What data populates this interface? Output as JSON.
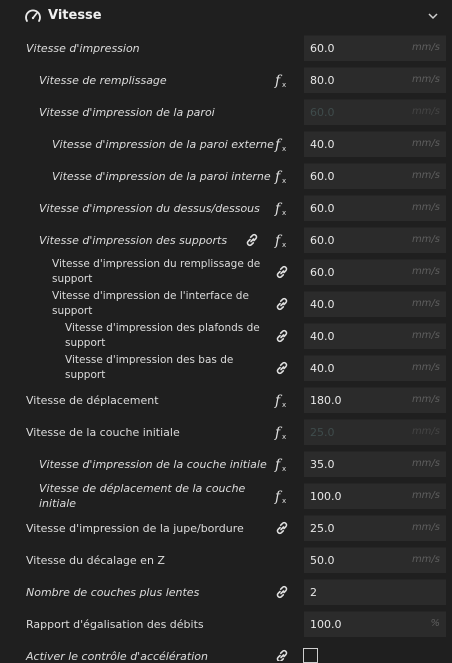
{
  "section": {
    "title": "Vitesse",
    "icon": "gauge-icon",
    "collapse_icon": "chevron-down-icon"
  },
  "rows": [
    {
      "label": "Vitesse d'impression",
      "value": "60.0",
      "unit": "mm/s",
      "icon": ""
    },
    {
      "label": "Vitesse de remplissage",
      "value": "80.0",
      "unit": "mm/s",
      "icon": "function-icon"
    },
    {
      "label": "Vitesse d'impression de la paroi",
      "value": "60.0",
      "unit": "mm/s",
      "icon": ""
    },
    {
      "label": "Vitesse d'impression de la paroi externe",
      "value": "40.0",
      "unit": "mm/s",
      "icon": "function-icon"
    },
    {
      "label": "Vitesse d'impression de la paroi interne",
      "value": "60.0",
      "unit": "mm/s",
      "icon": "function-icon"
    },
    {
      "label": "Vitesse d'impression du dessus/dessous",
      "value": "60.0",
      "unit": "mm/s",
      "icon": "function-icon"
    },
    {
      "label": "Vitesse d'impression des supports",
      "value": "60.0",
      "unit": "mm/s",
      "icon": "link+function"
    },
    {
      "label_line1": "Vitesse d'impression du remplissage de",
      "label_line2": "support",
      "value": "60.0",
      "unit": "mm/s",
      "icon": "link-icon"
    },
    {
      "label_line1": "Vitesse d'impression de l'interface de",
      "label_line2": "support",
      "value": "40.0",
      "unit": "mm/s",
      "icon": "link-icon"
    },
    {
      "label_line1": "Vitesse d'impression des plafonds de",
      "label_line2": "support",
      "value": "40.0",
      "unit": "mm/s",
      "icon": "link-icon"
    },
    {
      "label_line1": "Vitesse d'impression des bas de",
      "label_line2": "support",
      "value": "40.0",
      "unit": "mm/s",
      "icon": "link-icon"
    },
    {
      "label": "Vitesse de déplacement",
      "value": "180.0",
      "unit": "mm/s",
      "icon": "function-icon"
    },
    {
      "label": "Vitesse de la couche initiale",
      "value": "25.0",
      "unit": "mm/s",
      "icon": "function-icon"
    },
    {
      "label": "Vitesse d'impression de la couche initiale",
      "value": "35.0",
      "unit": "mm/s",
      "icon": "function-icon"
    },
    {
      "label": "Vitesse de déplacement de la couche initiale",
      "value": "100.0",
      "unit": "mm/s",
      "icon": "function-icon"
    },
    {
      "label": "Vitesse d'impression de la jupe/bordure",
      "value": "25.0",
      "unit": "mm/s",
      "icon": "link-icon"
    },
    {
      "label": "Vitesse du décalage en Z",
      "value": "50.0",
      "unit": "mm/s",
      "icon": ""
    },
    {
      "label": "Nombre de couches plus lentes",
      "value": "2",
      "unit": "",
      "icon": "link-icon"
    },
    {
      "label": "Rapport d'égalisation des débits",
      "value": "100.0",
      "unit": "%",
      "icon": ""
    },
    {
      "label": "Activer le contrôle d'accélération",
      "checked": false,
      "icon": "link-icon"
    }
  ],
  "colors": {
    "background": "#1f1f1f",
    "field": "#2b2b2b",
    "text": "#dcdcdc",
    "unit": "#5e5e5e",
    "disabled": "#3f4c4c"
  }
}
